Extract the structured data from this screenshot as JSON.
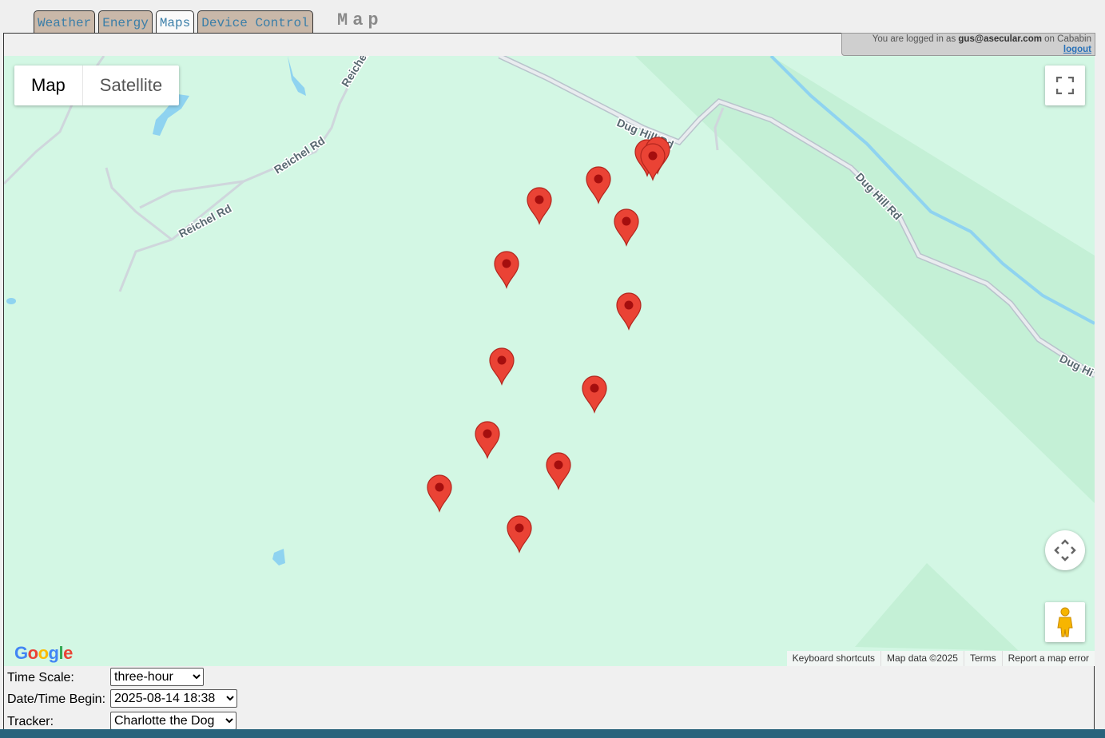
{
  "tabs": [
    {
      "label": "Weather"
    },
    {
      "label": "Energy"
    },
    {
      "label": "Maps"
    },
    {
      "label": "Device Control"
    }
  ],
  "page_heading": "Map",
  "login": {
    "prefix": "You are logged in as",
    "user": "gus@asecular.com",
    "connector": "on",
    "site": "Cababin",
    "logout_label": "logout"
  },
  "map": {
    "type_buttons": {
      "map": "Map",
      "satellite": "Satellite"
    },
    "road_labels": {
      "reichel_1": "Reichel",
      "reichel_2": "Reichel Rd",
      "reichel_3": "Reichel Rd",
      "dug_1": "Dug Hill Rd",
      "dug_2": "Dug Hill Rd",
      "dug_3": "Dug Hi"
    },
    "pin_color": "#ea4335",
    "pin_count": 14,
    "google_logo": "Google",
    "attribution": {
      "shortcuts": "Keyboard shortcuts",
      "data": "Map data ©2025",
      "terms": "Terms",
      "report": "Report a map error"
    }
  },
  "controls": {
    "time_scale": {
      "label": "Time Scale:",
      "value": "three-hour"
    },
    "date_begin": {
      "label": "Date/Time Begin:",
      "value": "2025-08-14 18:38"
    },
    "tracker": {
      "label": "Tracker:",
      "value": "Charlotte the Dog"
    }
  },
  "colors": {
    "tab_bg": "#c9b8a9",
    "tab_text": "#3a7ea8",
    "map_bg": "#d3f7e4",
    "water": "#8fd3f0",
    "bottom_bar": "#28637c"
  }
}
